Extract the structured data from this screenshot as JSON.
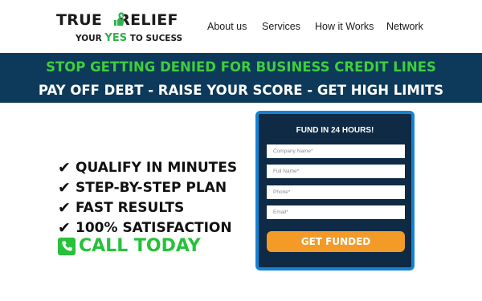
{
  "logo": {
    "brand_left": "TRUE",
    "brand_right": "RELIEF",
    "tag_pre": "YOUR ",
    "tag_yes": "YES",
    "tag_post": " TO SUCESS"
  },
  "nav": {
    "about": "About us",
    "services": "Services",
    "how": "How it Works",
    "network": "Network"
  },
  "banner": {
    "line1": "STOP GETTING DENIED FOR BUSINESS CREDIT LINES",
    "line2": "PAY OFF DEBT - RAISE YOUR SCORE - GET HIGH LIMITS"
  },
  "benefits": [
    {
      "label": "QUALIFY IN MINUTES"
    },
    {
      "label": "STEP-BY-STEP PLAN"
    },
    {
      "label": "FAST RESULTS"
    },
    {
      "label": "100% SATISFACTION"
    }
  ],
  "call": {
    "label": "CALL TODAY"
  },
  "form": {
    "title": "FUND IN 24 HOURS!",
    "company_placeholder": "Company Name*",
    "name_placeholder": "Full Name*",
    "phone_placeholder": "Phone*",
    "email_placeholder": "Email*",
    "submit_label": "GET FUNDED"
  },
  "colors": {
    "banner_bg": "#0d3a5a",
    "green": "#3ecf3a",
    "form_bg": "#0e2a44",
    "form_border": "#1583d4",
    "button": "#f39a27"
  },
  "icons": {
    "check": "check-icon",
    "phone": "phone-icon",
    "logo_mark": "thumbs-up-dollar-icon"
  }
}
